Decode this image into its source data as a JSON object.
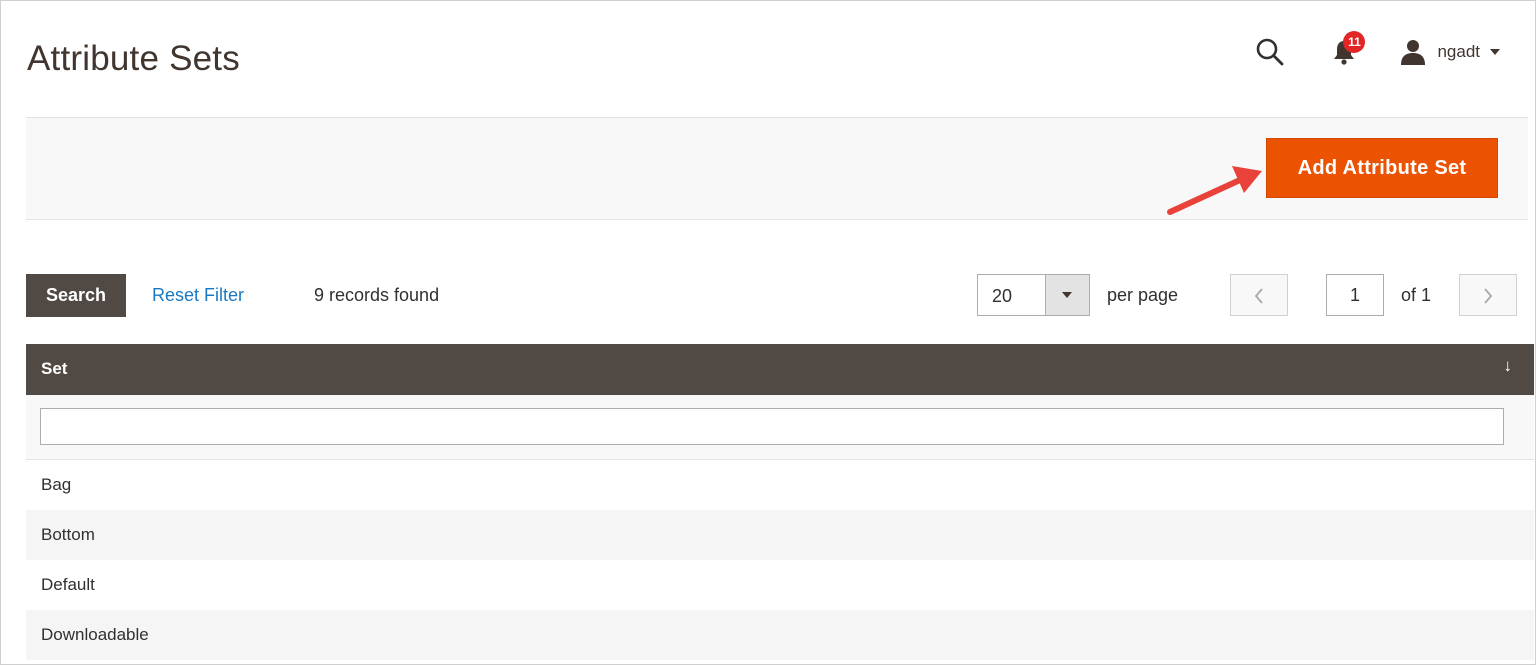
{
  "page": {
    "title": "Attribute Sets"
  },
  "header": {
    "notifications_count": "11",
    "username": "ngadt"
  },
  "actions": {
    "add_label": "Add Attribute Set"
  },
  "toolbar": {
    "search_label": "Search",
    "reset_label": "Reset Filter",
    "records_text": "9 records found",
    "per_page_value": "20",
    "per_page_label": "per page",
    "current_page": "1",
    "page_of": "of 1"
  },
  "grid": {
    "column_header": "Set",
    "sort_indicator": "↓",
    "filter_value": "",
    "rows": [
      "Bag",
      "Bottom",
      "Default",
      "Downloadable"
    ]
  },
  "colors": {
    "accent": "#eb5202",
    "header_dark": "#514943",
    "link": "#1979c3",
    "annotation_arrow": "#e8423b"
  }
}
